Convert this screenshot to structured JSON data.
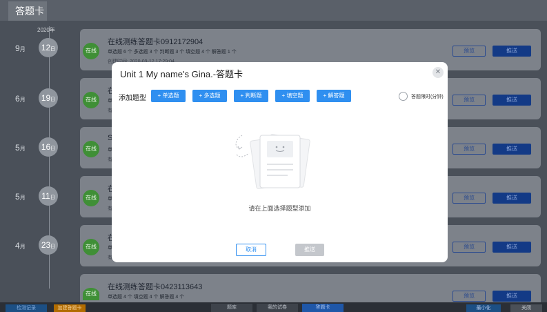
{
  "window": {
    "tab_title": "答题卡"
  },
  "timeline": {
    "year": "2020年",
    "entries": [
      {
        "month": "9",
        "month_unit": "月",
        "day": "12",
        "day_unit": "日"
      },
      {
        "month": "6",
        "month_unit": "月",
        "day": "19",
        "day_unit": "日"
      },
      {
        "month": "5",
        "month_unit": "月",
        "day": "16",
        "day_unit": "日"
      },
      {
        "month": "5",
        "month_unit": "月",
        "day": "11",
        "day_unit": "日"
      },
      {
        "month": "4",
        "month_unit": "月",
        "day": "23",
        "day_unit": "日"
      }
    ]
  },
  "cards": [
    {
      "badge": "在线",
      "title": "在线测练答题卡0912172904",
      "summary": "单选题 6 个   多选题 3 个   判断题 3 个   填空题 4 个   解答题 1 个",
      "time": "创建时间: 2020-09-12 17:29:04",
      "preview": "预览",
      "push": "推送"
    },
    {
      "badge": "在线",
      "title": "在",
      "summary": "单",
      "time": "有",
      "preview": "预览",
      "push": "推送"
    },
    {
      "badge": "在线",
      "title": "S",
      "summary": "单",
      "time": "有",
      "preview": "预览",
      "push": "推送"
    },
    {
      "badge": "在线",
      "title": "在",
      "summary": "单",
      "time": "有",
      "preview": "预览",
      "push": "推送"
    },
    {
      "badge": "在线",
      "title": "在",
      "summary": "单",
      "time": "有",
      "preview": "预览",
      "push": "推送"
    },
    {
      "badge": "在线",
      "title": "在线测练答题卡0423113643",
      "summary": "单选题 4 个   填空题 4 个   解答题 4 个",
      "time": "",
      "preview": "预览",
      "push": "推送"
    }
  ],
  "modal": {
    "title": "Unit 1 My name's Gina.-答题卡",
    "add_label": "添加题型",
    "types": [
      "+ 单选题",
      "+ 多选题",
      "+ 判断题",
      "+ 填空题",
      "+ 解答题"
    ],
    "timer_label": "答题限时(分钟)",
    "empty_hint": "请在上面选择题型添加",
    "cancel": "取消",
    "push": "推送"
  },
  "bottom": {
    "left_buttons": [
      "检测记录",
      "加建答题卡"
    ],
    "tabs": [
      "题库",
      "我的试卷",
      "答题卡"
    ],
    "active_tab": "答题卡",
    "minimize": "最小化",
    "close": "关闭"
  },
  "colors": {
    "primary": "#2f8ff0",
    "online": "#3f8f36",
    "push_dark": "#133a86"
  }
}
